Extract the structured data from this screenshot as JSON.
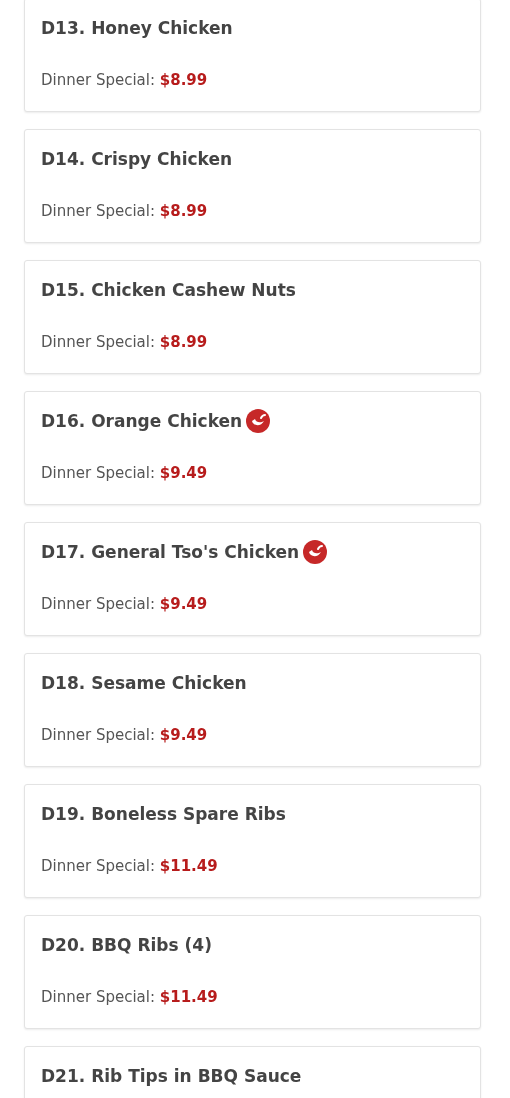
{
  "menu_items": [
    {
      "name": "D13. Honey Chicken",
      "spicy": false,
      "price_label": "Dinner Special:",
      "price": "$8.99"
    },
    {
      "name": "D14. Crispy Chicken",
      "spicy": false,
      "price_label": "Dinner Special:",
      "price": "$8.99"
    },
    {
      "name": "D15. Chicken Cashew Nuts",
      "spicy": false,
      "price_label": "Dinner Special:",
      "price": "$8.99"
    },
    {
      "name": "D16. Orange Chicken",
      "spicy": true,
      "price_label": "Dinner Special:",
      "price": "$9.49"
    },
    {
      "name": "D17. General Tso's Chicken",
      "spicy": true,
      "price_label": "Dinner Special:",
      "price": "$9.49"
    },
    {
      "name": "D18. Sesame Chicken",
      "spicy": false,
      "price_label": "Dinner Special:",
      "price": "$9.49"
    },
    {
      "name": "D19. Boneless Spare Ribs",
      "spicy": false,
      "price_label": "Dinner Special:",
      "price": "$11.49"
    },
    {
      "name": "D20. BBQ Ribs (4)",
      "spicy": false,
      "price_label": "Dinner Special:",
      "price": "$11.49"
    },
    {
      "name": "D21. Rib Tips in BBQ Sauce",
      "spicy": false
    }
  ]
}
